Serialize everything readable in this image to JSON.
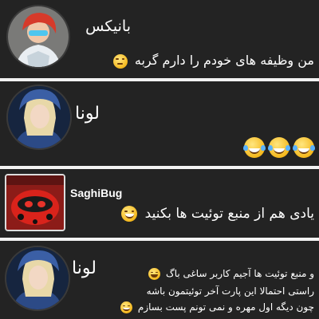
{
  "posts": [
    {
      "author": "بانیکس",
      "text": "من وظیفه های خودم را دارم گربه",
      "emoji": "unamused-face-icon"
    },
    {
      "author": "لونا",
      "text": "",
      "emoji": "tears-of-joy-face-icon"
    },
    {
      "author": "SaghiBug",
      "text": "یادی هم از منبع توئیت ها بکنید",
      "emoji": "grinning-sweat-face-icon"
    },
    {
      "author": "لونا",
      "lines": [
        "و منبع توئیت ها آجیم کاربر ساغی باگ",
        "راستی احتمالا این پارت آخر توئیتمون باشه",
        "چون دیگه اول مهره و نمی تونم پست بسازم"
      ],
      "emoji": "winking-face-icon"
    }
  ],
  "colors": {
    "background": "#232323",
    "separator": "#f2f2f2",
    "text": "#ffffff"
  }
}
